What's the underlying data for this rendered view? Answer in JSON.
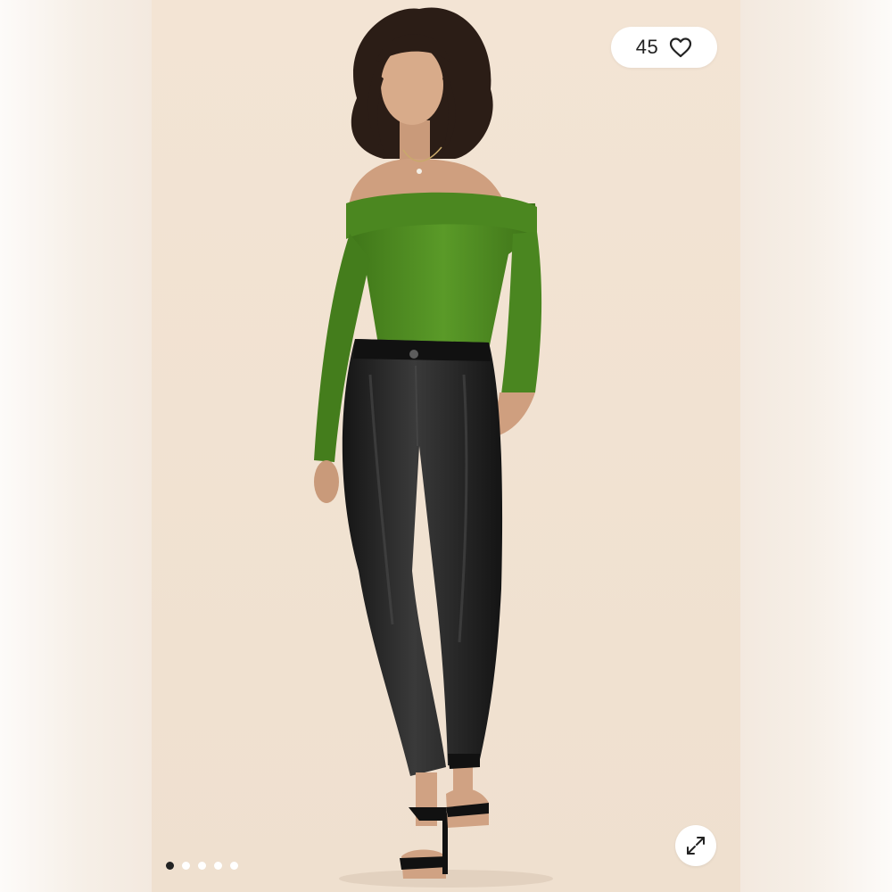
{
  "listing_image": {
    "likes": {
      "count": "45",
      "icon": "heart-icon"
    },
    "expand": {
      "icon": "expand-arrows-icon"
    },
    "carousel": {
      "total_images": 5,
      "active_index": 0
    },
    "colors": {
      "backdrop": "#f2e3d3",
      "top": "#4e8a22",
      "pants": "#1e1e1e",
      "pill": "#ffffff",
      "active_dot": "#222222"
    }
  }
}
